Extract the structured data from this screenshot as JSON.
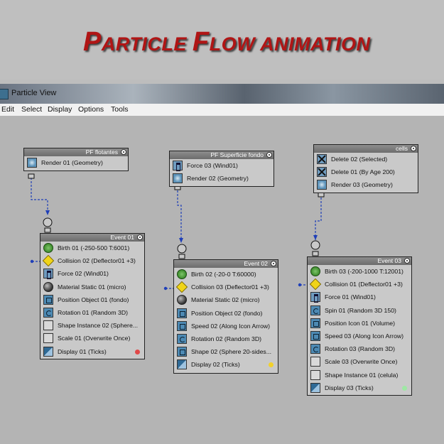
{
  "headline": {
    "first_cap": "P",
    "first_rest": "ARTICLE ",
    "second_cap": "F",
    "second_rest": "LOW ANIMATION"
  },
  "window": {
    "title": "Particle View",
    "icon": "app-icon"
  },
  "menu": [
    "Edit",
    "Select",
    "Display",
    "Options",
    "Tools"
  ],
  "colors": {
    "headline": "#b01515",
    "red_dot": "#e04848",
    "yellow_dot": "#f2d12a",
    "green_dot": "#9ee8a4"
  },
  "nodes": {
    "pf_flotantes": {
      "title": "PF flotantes",
      "ops": [
        {
          "label": "Render 01 (Geometry)",
          "icon": "render-icon"
        }
      ]
    },
    "pf_superficie": {
      "title": "PF Superficie fondo",
      "ops": [
        {
          "label": "Force 03 (Wind01)",
          "icon": "force-icon"
        },
        {
          "label": "Render 02 (Geometry)",
          "icon": "render-icon"
        }
      ]
    },
    "cells": {
      "title": "cells",
      "ops": [
        {
          "label": "Delete 02 (Selected)",
          "icon": "delete-icon"
        },
        {
          "label": "Delete 01 (By Age 200)",
          "icon": "delete-icon"
        },
        {
          "label": "Render 03 (Geometry)",
          "icon": "render-icon"
        }
      ]
    },
    "event01": {
      "title": "Event 01",
      "ops": [
        {
          "label": "Birth 01 (-250-500 T:6001)",
          "icon": "birth-icon"
        },
        {
          "label": "Collision 02 (Deflector01 +3)",
          "icon": "collision-icon"
        },
        {
          "label": "Force 02 (Wind01)",
          "icon": "force-icon"
        },
        {
          "label": "Material Static 01 (micro)",
          "icon": "material-icon"
        },
        {
          "label": "Position Object 01 (fondo)",
          "icon": "position-icon"
        },
        {
          "label": "Rotation 01 (Random 3D)",
          "icon": "rotation-icon"
        },
        {
          "label": "Shape Instance 02 (Sphere...",
          "icon": "shape-icon"
        },
        {
          "label": "Scale 01 (Overwrite Once)",
          "icon": "scale-icon"
        },
        {
          "label": "Display 01 (Ticks)",
          "icon": "display-icon"
        }
      ]
    },
    "event02": {
      "title": "Event 02",
      "ops": [
        {
          "label": "Birth 02 (-20-0 T:60000)",
          "icon": "birth-icon"
        },
        {
          "label": "Collision 03 (Deflector01 +3)",
          "icon": "collision-icon"
        },
        {
          "label": "Material Static 02 (micro)",
          "icon": "material-icon"
        },
        {
          "label": "Position Object 02 (fondo)",
          "icon": "position-icon"
        },
        {
          "label": "Speed 02 (Along Icon Arrow)",
          "icon": "speed-icon"
        },
        {
          "label": "Rotation 02 (Random 3D)",
          "icon": "rotation-icon"
        },
        {
          "label": "Shape 02 (Sphere 20-sides...",
          "icon": "shape-icon"
        },
        {
          "label": "Display 02 (Ticks)",
          "icon": "display-icon"
        }
      ]
    },
    "event03": {
      "title": "Event 03",
      "ops": [
        {
          "label": "Birth 03 (-200-1000 T:12001)",
          "icon": "birth-icon"
        },
        {
          "label": "Collision 01 (Deflector01 +3)",
          "icon": "collision-icon"
        },
        {
          "label": "Force 01 (Wind01)",
          "icon": "force-icon"
        },
        {
          "label": "Spin 01 (Random 3D 150)",
          "icon": "spin-icon"
        },
        {
          "label": "Position Icon 01 (Volume)",
          "icon": "position-icon"
        },
        {
          "label": "Speed 03 (Along Icon Arrow)",
          "icon": "speed-icon"
        },
        {
          "label": "Rotation 03 (Random 3D)",
          "icon": "rotation-icon"
        },
        {
          "label": "Scale 03 (Overwrite Once)",
          "icon": "scale-icon"
        },
        {
          "label": "Shape Instance 01 (celula)",
          "icon": "shape-icon"
        },
        {
          "label": "Display 03 (Ticks)",
          "icon": "display-icon"
        }
      ]
    }
  }
}
